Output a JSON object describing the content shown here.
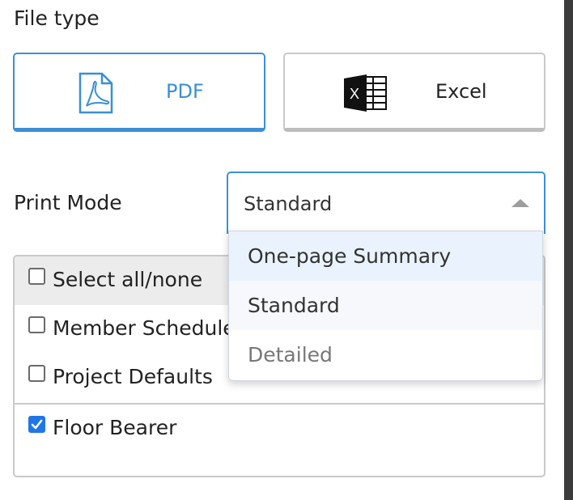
{
  "file_type": {
    "title": "File type",
    "options": [
      {
        "label": "PDF",
        "icon": "pdf-icon",
        "selected": true
      },
      {
        "label": "Excel",
        "icon": "excel-icon",
        "selected": false
      }
    ],
    "accent": "#3d8fd6"
  },
  "print_mode": {
    "label": "Print Mode",
    "value": "Standard",
    "dropdown_open": true,
    "options": [
      "One-page Summary",
      "Standard",
      "Detailed"
    ]
  },
  "items": [
    {
      "label": "Select all/none",
      "checked": false
    },
    {
      "label": "Member Schedule",
      "checked": false
    },
    {
      "label": "Project Defaults",
      "checked": false
    },
    {
      "label": "Floor Bearer",
      "checked": true
    }
  ]
}
